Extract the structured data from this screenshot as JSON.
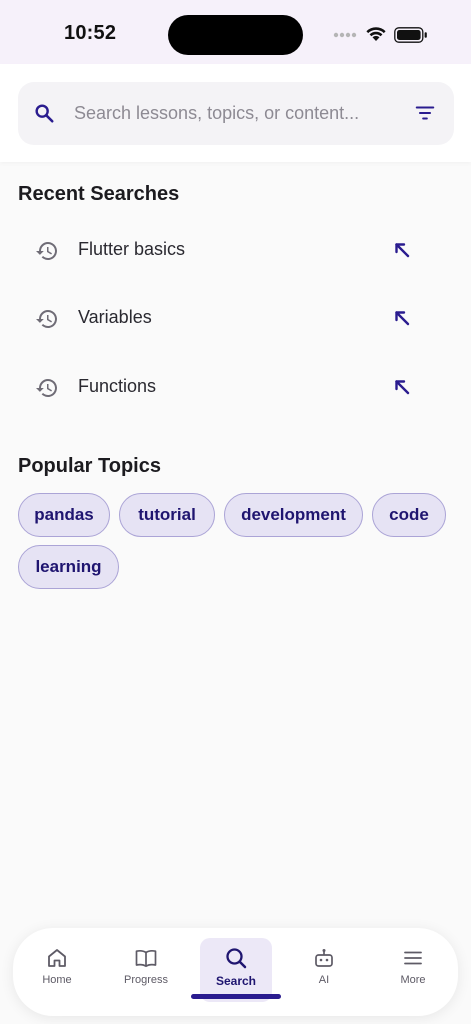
{
  "status_bar": {
    "time": "10:52"
  },
  "search": {
    "placeholder": "Search lessons, topics, or content...",
    "value": ""
  },
  "recent": {
    "title": "Recent Searches",
    "items": [
      {
        "label": "Flutter basics"
      },
      {
        "label": "Variables"
      },
      {
        "label": "Functions"
      }
    ]
  },
  "popular": {
    "title": "Popular Topics",
    "chips": [
      "pandas",
      "tutorial",
      "development",
      "code",
      "learning"
    ]
  },
  "nav": {
    "items": [
      {
        "label": "Home",
        "icon": "home-icon"
      },
      {
        "label": "Progress",
        "icon": "book-icon"
      },
      {
        "label": "Search",
        "icon": "search-icon",
        "active": true
      },
      {
        "label": "AI",
        "icon": "robot-icon"
      },
      {
        "label": "More",
        "icon": "menu-icon"
      }
    ]
  },
  "colors": {
    "accent": "#2a1c8f",
    "chip_bg": "#e6e3f4",
    "chip_border": "#aba4d6",
    "header_bg": "#f6f1fa",
    "page_bg": "#fafafa"
  }
}
